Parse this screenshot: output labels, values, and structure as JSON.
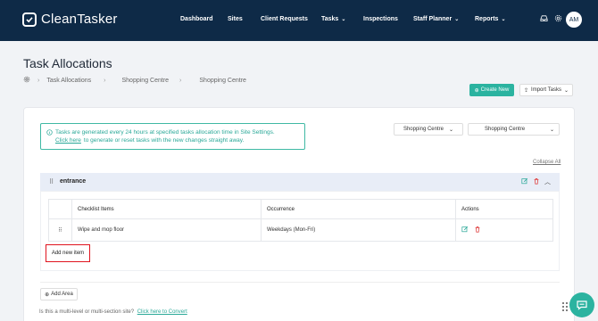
{
  "app": {
    "name": "CleanTasker"
  },
  "nav": {
    "items": [
      {
        "label": "Dashboard",
        "has_dropdown": false
      },
      {
        "label": "Sites",
        "has_dropdown": false
      },
      {
        "label": "Client Requests",
        "has_dropdown": false
      },
      {
        "label": "Tasks",
        "has_dropdown": true
      },
      {
        "label": "Inspections",
        "has_dropdown": false
      },
      {
        "label": "Staff Planner",
        "has_dropdown": true
      },
      {
        "label": "Reports",
        "has_dropdown": true
      }
    ],
    "icons": [
      "inbox-icon",
      "gear-icon"
    ],
    "avatar_initials": "AM"
  },
  "page": {
    "title": "Task Allocations",
    "breadcrumb": [
      "Task Allocations",
      "Shopping Centre",
      "Shopping Centre"
    ]
  },
  "actions": {
    "create_new": "Create New",
    "import_tasks": "Import Tasks"
  },
  "info": {
    "line1": "Tasks are generated every 24 hours at specified tasks allocation time in Site Settings.",
    "link": "Click here",
    "line2_rest": "to generate or reset tasks with the new changes straight away."
  },
  "filters": {
    "select1": "Shopping Centre",
    "select2": "Shopping Centre"
  },
  "collapse_all": "Collapse All",
  "section": {
    "title": "entrance",
    "table": {
      "headers": [
        "Checklist Items",
        "Occurrence",
        "Actions"
      ],
      "rows": [
        {
          "item": "Wipe and mop floor",
          "occurrence": "Weekdays (Mon-Fri)"
        }
      ]
    },
    "add_item": "Add new item"
  },
  "add_area": "Add Area",
  "multi_level": {
    "text": "Is this a multi-level or multi-section site?",
    "link": "Click here to Convert"
  },
  "colors": {
    "topbar": "#0e2a47",
    "accent": "#2bb3a0",
    "highlight_border": "#e0141e"
  }
}
